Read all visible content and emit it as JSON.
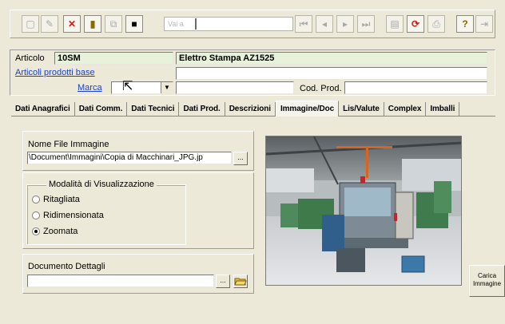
{
  "toolbar": {
    "new_icon": "new-document-icon",
    "edit_icon": "edit-document-icon",
    "delete_icon": "delete-x-icon",
    "trash_icon": "trash-icon",
    "copy_icon": "copy-icon",
    "save_icon": "save-icon",
    "goto_label": "Vai a",
    "first_icon": "first-record-icon",
    "prev_icon": "previous-record-icon",
    "next_icon": "next-record-icon",
    "last_icon": "last-record-icon",
    "preview_icon": "print-preview-icon",
    "refresh_icon": "refresh-icon",
    "print_icon": "print-icon",
    "help_icon": "help-icon",
    "exit_icon": "exit-icon"
  },
  "header": {
    "articolo_label": "Articolo",
    "articolo_code": "10SM",
    "articolo_description": "Elettro Stampa AZ1525",
    "articoli_base_link": "Articoli prodotti base",
    "marca_label": "Marca",
    "marca_value": "",
    "cod_prod_label": "Cod. Prod.",
    "cod_prod_value": ""
  },
  "tabs": [
    {
      "label": "Dati Anagrafici"
    },
    {
      "label": "Dati Comm."
    },
    {
      "label": "Dati Tecnici"
    },
    {
      "label": "Dati Prod."
    },
    {
      "label": "Descrizioni"
    },
    {
      "label": "Immagine/Doc"
    },
    {
      "label": "Lis/Valute"
    },
    {
      "label": "Complex"
    },
    {
      "label": "Imballi"
    }
  ],
  "active_tab": "Immagine/Doc",
  "image_panel": {
    "file_label": "Nome File Immagine",
    "file_value": "\\Document\\Immagini\\Copia di Macchinari_JPG.jp",
    "browse_label": "...",
    "mode_title": "Modalità di Visualizzazione",
    "modes": [
      {
        "label": "Ritagliata",
        "checked": false
      },
      {
        "label": "Ridimensionata",
        "checked": false
      },
      {
        "label": "Zoomata",
        "checked": true
      }
    ],
    "doc_label": "Documento Dettagli",
    "doc_value": "",
    "doc_browse_label": "...",
    "carica_label": "Carica Immagine"
  }
}
